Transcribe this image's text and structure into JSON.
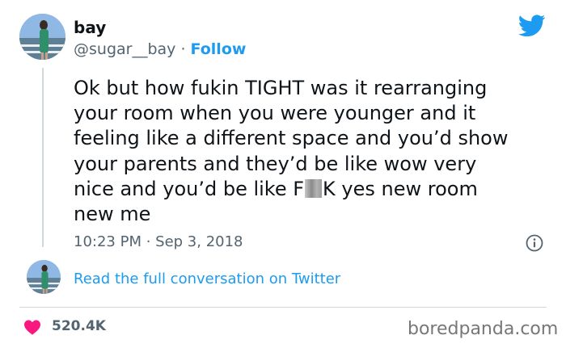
{
  "author": {
    "display_name": "bay",
    "handle": "@sugar__bay",
    "separator": " · ",
    "follow_label": "Follow",
    "avatar_icon": "user-avatar-photo"
  },
  "tweet": {
    "text_before": "Ok but how fukin TIGHT was it rearranging\nyour room when you were younger and it\nfeeling like a different space and you’d show\nyour parents and they’d be like wow very\nnice and you’d be like F",
    "text_after": "K yes new room\nnew me",
    "timestamp": "10:23 PM · Sep 3, 2018"
  },
  "conversation": {
    "read_label": "Read the full conversation on Twitter"
  },
  "engagement": {
    "likes": "520.4K",
    "like_icon": "heart-icon"
  },
  "branding": {
    "platform_icon": "twitter-bird-icon",
    "watermark": "boredpanda.com"
  },
  "colors": {
    "accent": "#1d9bf0",
    "heart": "#f91880",
    "secondary_text": "#536471",
    "divider": "#cfd9de"
  }
}
